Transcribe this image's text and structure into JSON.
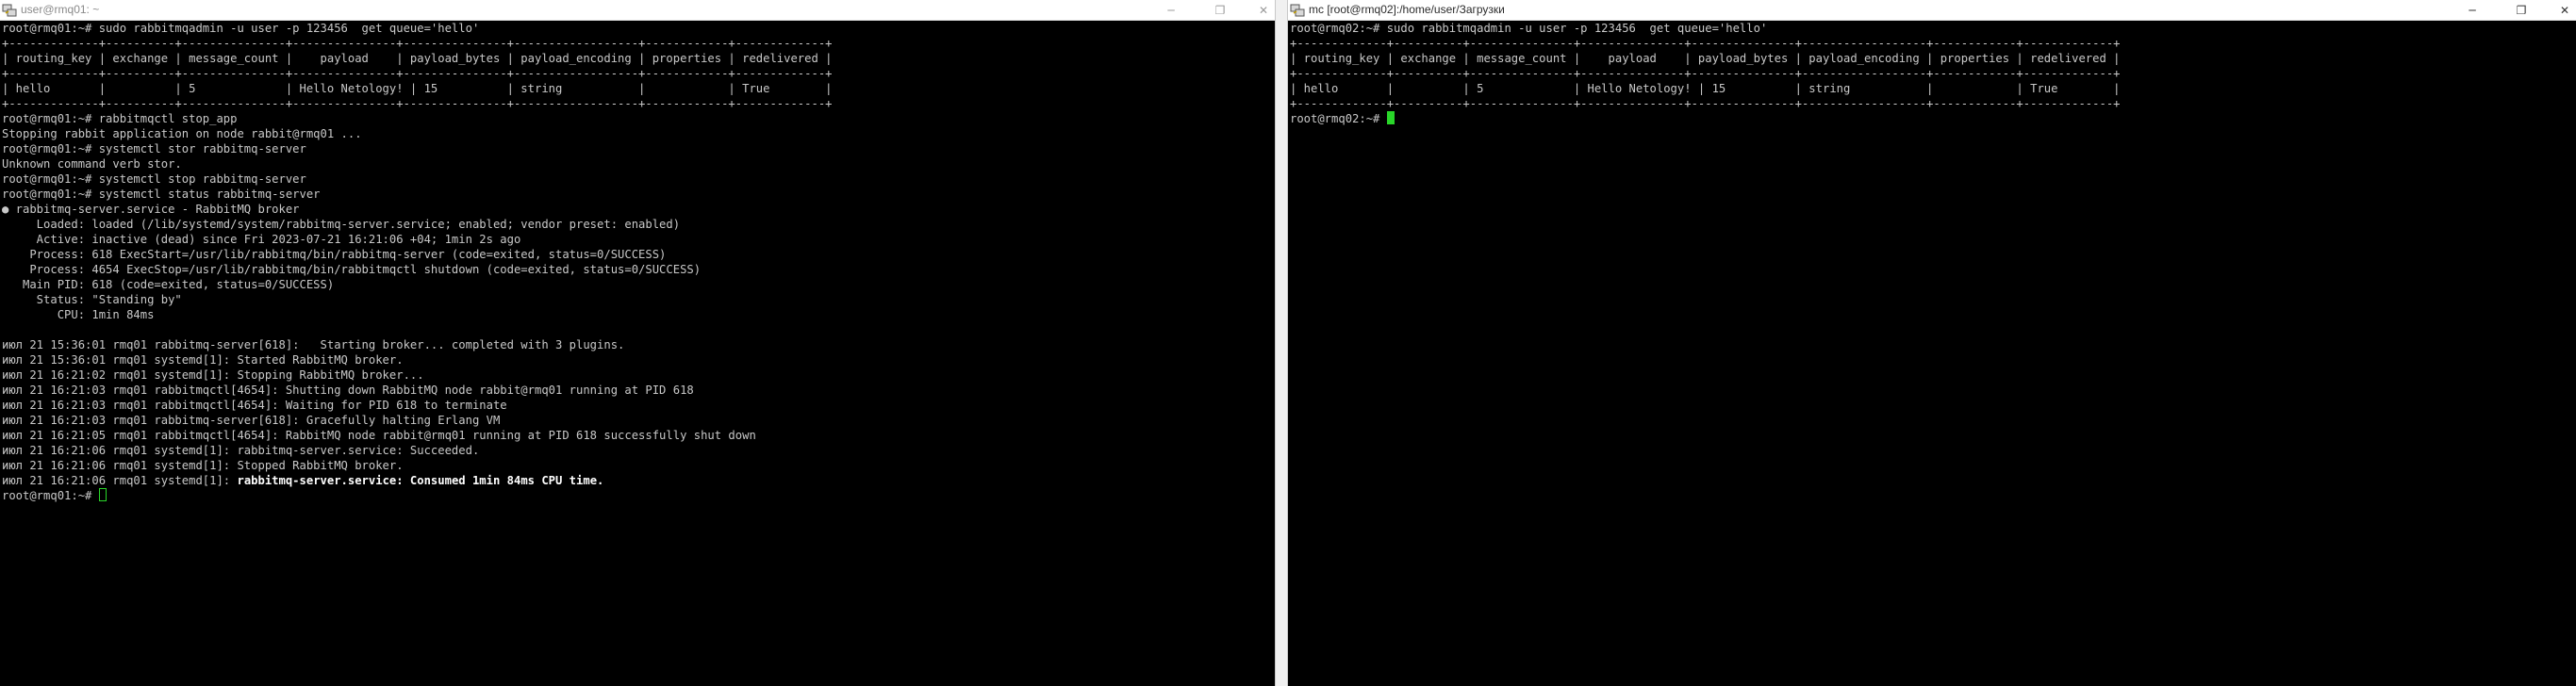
{
  "window1": {
    "title": "user@rmq01: ~",
    "lines": [
      "root@rmq01:~# sudo rabbitmqadmin -u user -p 123456  get queue='hello'",
      "+-------------+----------+---------------+---------------+---------------+------------------+------------+-------------+",
      "| routing_key | exchange | message_count |    payload    | payload_bytes | payload_encoding | properties | redelivered |",
      "+-------------+----------+---------------+---------------+---------------+------------------+------------+-------------+",
      "| hello       |          | 5             | Hello Netology! | 15          | string           |            | True        |",
      "+-------------+----------+---------------+---------------+---------------+------------------+------------+-------------+",
      "root@rmq01:~# rabbitmqctl stop_app",
      "Stopping rabbit application on node rabbit@rmq01 ...",
      "root@rmq01:~# systemctl stor rabbitmq-server",
      "Unknown command verb stor.",
      "root@rmq01:~# systemctl stop rabbitmq-server",
      "root@rmq01:~# systemctl status rabbitmq-server",
      "● rabbitmq-server.service - RabbitMQ broker",
      "     Loaded: loaded (/lib/systemd/system/rabbitmq-server.service; enabled; vendor preset: enabled)",
      "     Active: inactive (dead) since Fri 2023-07-21 16:21:06 +04; 1min 2s ago",
      "    Process: 618 ExecStart=/usr/lib/rabbitmq/bin/rabbitmq-server (code=exited, status=0/SUCCESS)",
      "    Process: 4654 ExecStop=/usr/lib/rabbitmq/bin/rabbitmqctl shutdown (code=exited, status=0/SUCCESS)",
      "   Main PID: 618 (code=exited, status=0/SUCCESS)",
      "     Status: \"Standing by\"",
      "        CPU: 1min 84ms",
      "",
      "июл 21 15:36:01 rmq01 rabbitmq-server[618]:   Starting broker... completed with 3 plugins.",
      "июл 21 15:36:01 rmq01 systemd[1]: Started RabbitMQ broker.",
      "июл 21 16:21:02 rmq01 systemd[1]: Stopping RabbitMQ broker...",
      "июл 21 16:21:03 rmq01 rabbitmqctl[4654]: Shutting down RabbitMQ node rabbit@rmq01 running at PID 618",
      "июл 21 16:21:03 rmq01 rabbitmqctl[4654]: Waiting for PID 618 to terminate",
      "июл 21 16:21:03 rmq01 rabbitmq-server[618]: Gracefully halting Erlang VM",
      "июл 21 16:21:05 rmq01 rabbitmqctl[4654]: RabbitMQ node rabbit@rmq01 running at PID 618 successfully shut down",
      "июл 21 16:21:06 rmq01 systemd[1]: rabbitmq-server.service: Succeeded.",
      "июл 21 16:21:06 rmq01 systemd[1]: Stopped RabbitMQ broker."
    ],
    "bold_line_prefix": "июл 21 16:21:06 rmq01 systemd[1]: ",
    "bold_line_highlight": "rabbitmq-server.service: Consumed 1min 84ms CPU time.",
    "prompt": "root@rmq01:~# "
  },
  "window2": {
    "title": "mc [root@rmq02]:/home/user/Загрузки",
    "lines": [
      "root@rmq02:~# sudo rabbitmqadmin -u user -p 123456  get queue='hello'",
      "+-------------+----------+---------------+---------------+---------------+------------------+------------+-------------+",
      "| routing_key | exchange | message_count |    payload    | payload_bytes | payload_encoding | properties | redelivered |",
      "+-------------+----------+---------------+---------------+---------------+------------------+------------+-------------+",
      "| hello       |          | 5             | Hello Netology! | 15          | string           |            | True        |",
      "+-------------+----------+---------------+---------------+---------------+------------------+------------+-------------+"
    ],
    "prompt": "root@rmq02:~# "
  },
  "controls": {
    "minimize": "─",
    "maximize": "❐",
    "close": "✕"
  },
  "colors": {
    "terminal_bg": "#000000",
    "terminal_fg": "#c8c8c8",
    "cursor": "#29d629"
  }
}
